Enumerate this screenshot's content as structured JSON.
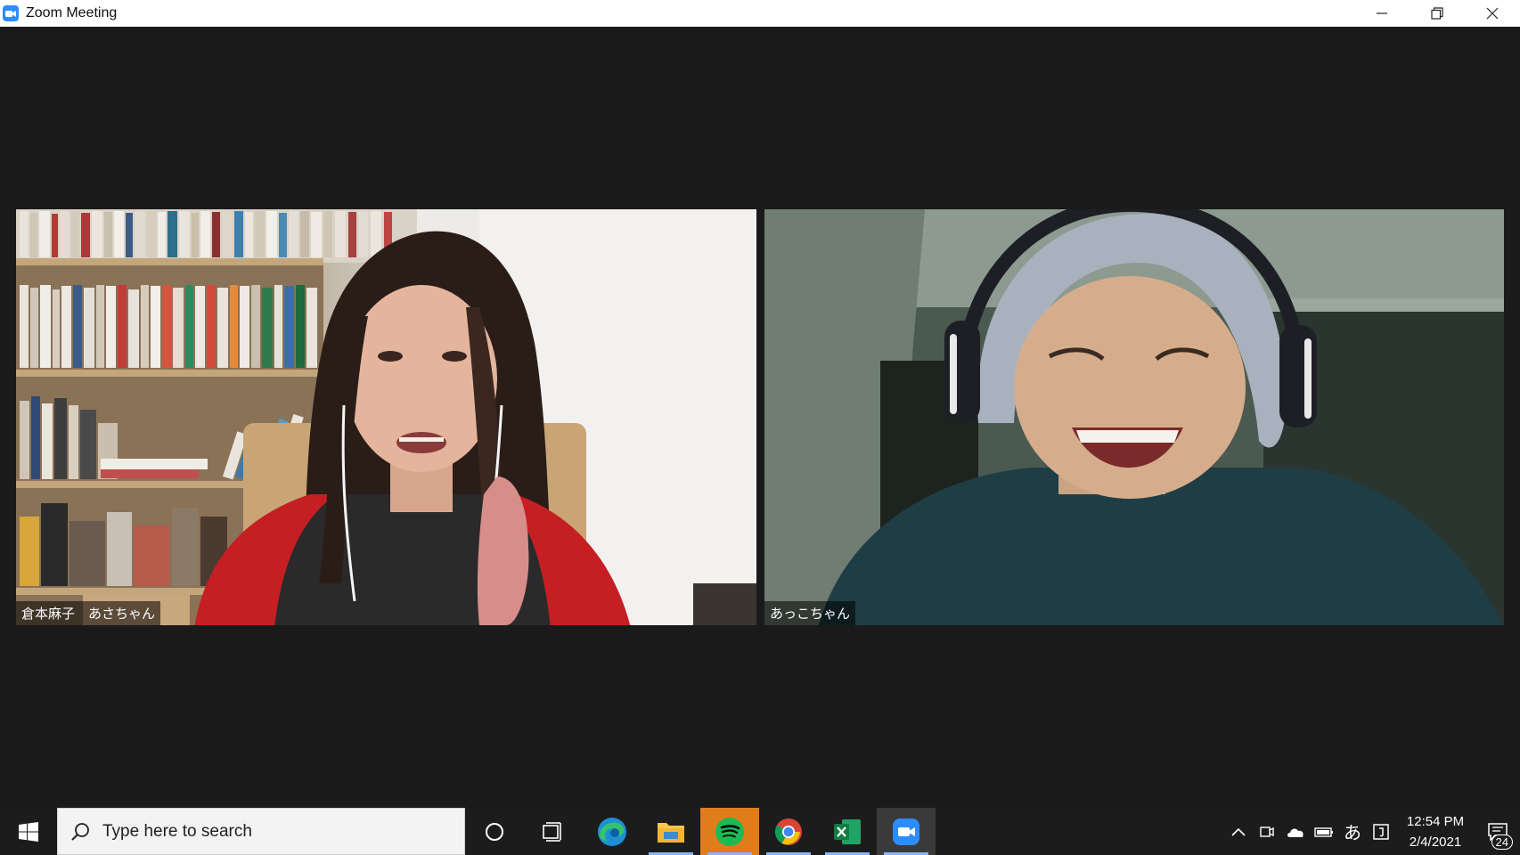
{
  "window": {
    "title": "Zoom Meeting",
    "icon": "zoom-camera-icon",
    "controls": [
      "minimize-icon",
      "restore-icon",
      "close-icon"
    ]
  },
  "participants": [
    {
      "name": "倉本麻子　あさちゃん"
    },
    {
      "name": "あっこちゃん"
    }
  ],
  "taskbar": {
    "search_placeholder": "Type here to search",
    "pinned": [
      {
        "name": "cortana-icon"
      },
      {
        "name": "task-view-icon"
      },
      {
        "name": "edge-icon"
      },
      {
        "name": "file-explorer-icon"
      },
      {
        "name": "spotify-icon"
      },
      {
        "name": "chrome-icon"
      },
      {
        "name": "excel-icon"
      },
      {
        "name": "zoom-icon"
      }
    ],
    "tray": {
      "ime": "あ",
      "time": "12:54 PM",
      "date": "2/4/2021",
      "notification_count": "24"
    }
  },
  "colors": {
    "background": "#1a1a1a",
    "zoom_blue": "#2d8cff",
    "spotify_green": "#1db954",
    "spotify_highlight": "#e07d1b"
  }
}
